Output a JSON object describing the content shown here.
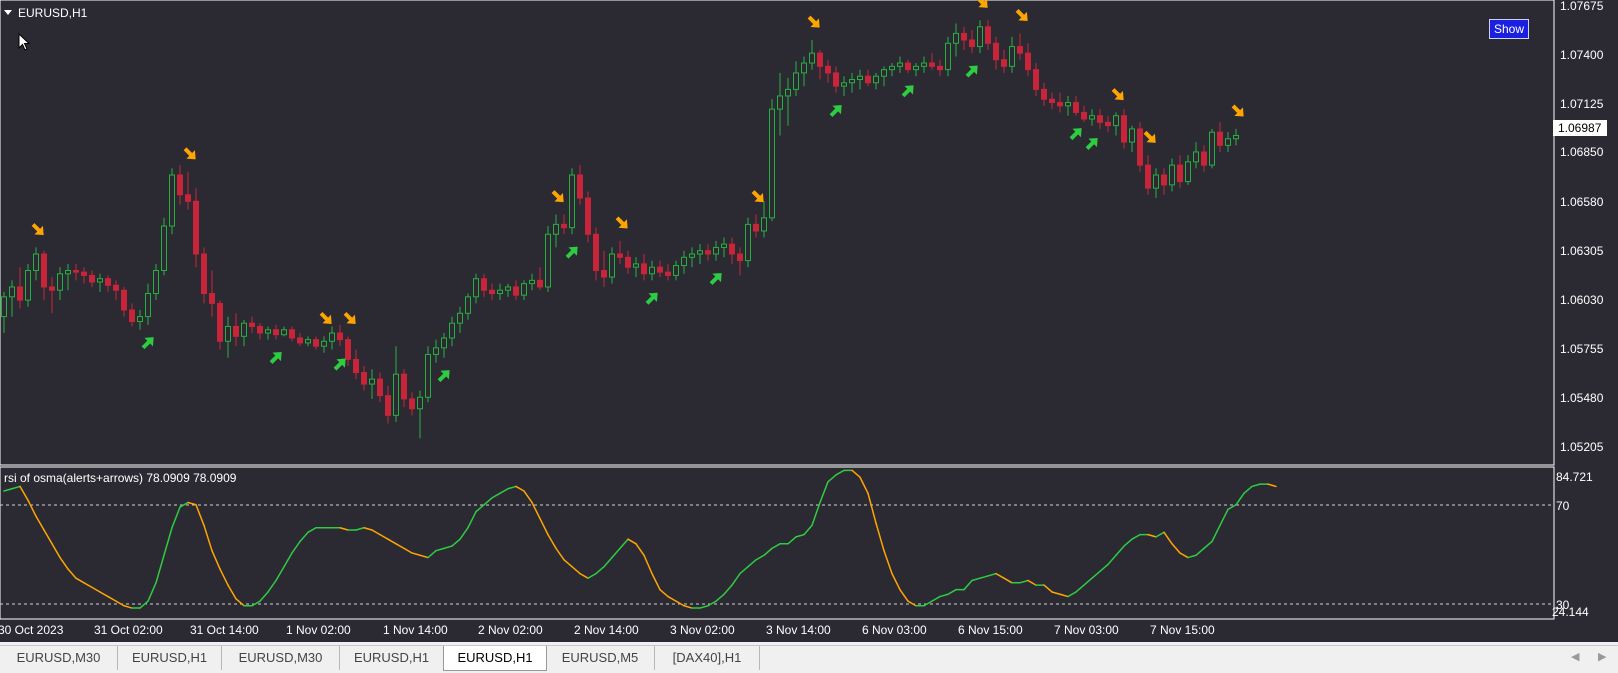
{
  "chart_window": {
    "title": "EURUSD,H1",
    "show_button": "Show",
    "current_price": "1.06987"
  },
  "colors": {
    "background": "#2b2a33",
    "bull": "#26b040",
    "bear": "#c8243a",
    "arrow_up": "#2ecc40",
    "arrow_down": "#ffa500",
    "osc_up": "#2ecc40",
    "osc_down": "#ffa500"
  },
  "price_axis": {
    "labels": [
      "1.07675",
      "1.07400",
      "1.07125",
      "1.06850",
      "1.06580",
      "1.06305",
      "1.06030",
      "1.05755",
      "1.05480",
      "1.05205"
    ]
  },
  "indicator": {
    "title": "rsi of osma(alerts+arrows) 78.0909 78.0909",
    "axis_labels": [
      "84.721",
      "70",
      "30",
      "24.144"
    ]
  },
  "time_axis": {
    "labels": [
      "30 Oct 2023",
      "31 Oct 02:00",
      "31 Oct 14:00",
      "1 Nov 02:00",
      "1 Nov 14:00",
      "2 Nov 02:00",
      "2 Nov 14:00",
      "3 Nov 02:00",
      "3 Nov 14:00",
      "6 Nov 03:00",
      "6 Nov 15:00",
      "7 Nov 03:00",
      "7 Nov 15:00"
    ]
  },
  "tabs": [
    {
      "label": "EURUSD,M30",
      "active": false
    },
    {
      "label": "EURUSD,H1",
      "active": false
    },
    {
      "label": "EURUSD,M30",
      "active": false
    },
    {
      "label": "EURUSD,H1",
      "active": false
    },
    {
      "label": "EURUSD,H1",
      "active": true
    },
    {
      "label": "EURUSD,M5",
      "active": false
    },
    {
      "label": "[DAX40],H1",
      "active": false
    }
  ],
  "chart_data": {
    "type": "candlestick",
    "symbol": "EURUSD",
    "timeframe": "H1",
    "y_range": [
      1.0512,
      1.0775
    ],
    "candles": [
      [
        1.059,
        1.0605,
        1.058,
        1.0602
      ],
      [
        1.0602,
        1.0612,
        1.059,
        1.0608
      ],
      [
        1.0608,
        1.062,
        1.0595,
        1.06
      ],
      [
        1.06,
        1.0622,
        1.0596,
        1.0618
      ],
      [
        1.0618,
        1.0632,
        1.0612,
        1.0628
      ],
      [
        1.0628,
        1.063,
        1.06,
        1.0608
      ],
      [
        1.0608,
        1.0614,
        1.0592,
        1.0606
      ],
      [
        1.0606,
        1.062,
        1.06,
        1.0616
      ],
      [
        1.0616,
        1.0622,
        1.0606,
        1.0618
      ],
      [
        1.0618,
        1.0622,
        1.0612,
        1.0617
      ],
      [
        1.0617,
        1.062,
        1.061,
        1.0615
      ],
      [
        1.0615,
        1.0618,
        1.0608,
        1.0611
      ],
      [
        1.0611,
        1.0616,
        1.0605,
        1.0613
      ],
      [
        1.0613,
        1.0615,
        1.0605,
        1.0609
      ],
      [
        1.0609,
        1.0612,
        1.06,
        1.0606
      ],
      [
        1.0606,
        1.0608,
        1.059,
        1.0594
      ],
      [
        1.0594,
        1.0598,
        1.0584,
        1.0587
      ],
      [
        1.0587,
        1.0594,
        1.0582,
        1.059
      ],
      [
        1.059,
        1.061,
        1.0585,
        1.0604
      ],
      [
        1.0604,
        1.0622,
        1.06,
        1.0618
      ],
      [
        1.0618,
        1.065,
        1.0615,
        1.0645
      ],
      [
        1.0645,
        1.068,
        1.064,
        1.0676
      ],
      [
        1.0676,
        1.0682,
        1.0658,
        1.0664
      ],
      [
        1.0664,
        1.0678,
        1.0655,
        1.066
      ],
      [
        1.066,
        1.0668,
        1.062,
        1.0628
      ],
      [
        1.0628,
        1.0632,
        1.0598,
        1.0604
      ],
      [
        1.0604,
        1.0618,
        1.059,
        1.0598
      ],
      [
        1.0598,
        1.06,
        1.057,
        1.0575
      ],
      [
        1.0575,
        1.059,
        1.0565,
        1.0584
      ],
      [
        1.0584,
        1.0592,
        1.0572,
        1.0578
      ],
      [
        1.0578,
        1.0588,
        1.0572,
        1.0586
      ],
      [
        1.0586,
        1.059,
        1.058,
        1.0584
      ],
      [
        1.0584,
        1.0586,
        1.0576,
        1.058
      ],
      [
        1.058,
        1.0584,
        1.0576,
        1.0582
      ],
      [
        1.0582,
        1.0585,
        1.0576,
        1.0579
      ],
      [
        1.0579,
        1.0584,
        1.0578,
        1.0582
      ],
      [
        1.0582,
        1.0584,
        1.0575,
        1.0577
      ],
      [
        1.0577,
        1.058,
        1.0572,
        1.0574
      ],
      [
        1.0574,
        1.0578,
        1.0572,
        1.0576
      ],
      [
        1.0576,
        1.0578,
        1.057,
        1.0572
      ],
      [
        1.0572,
        1.0578,
        1.0568,
        1.0575
      ],
      [
        1.0575,
        1.0584,
        1.057,
        1.058
      ],
      [
        1.058,
        1.0585,
        1.0572,
        1.0576
      ],
      [
        1.0576,
        1.0578,
        1.056,
        1.0564
      ],
      [
        1.0564,
        1.057,
        1.0552,
        1.0556
      ],
      [
        1.0556,
        1.056,
        1.0545,
        1.0549
      ],
      [
        1.0549,
        1.0558,
        1.054,
        1.0552
      ],
      [
        1.0552,
        1.0556,
        1.0538,
        1.0542
      ],
      [
        1.0542,
        1.0548,
        1.0525,
        1.053
      ],
      [
        1.053,
        1.0572,
        1.0526,
        1.0555
      ],
      [
        1.0555,
        1.0558,
        1.0535,
        1.054
      ],
      [
        1.054,
        1.0544,
        1.053,
        1.0534
      ],
      [
        1.0534,
        1.0545,
        1.0516,
        1.0541
      ],
      [
        1.0541,
        1.0572,
        1.0538,
        1.0567
      ],
      [
        1.0567,
        1.0576,
        1.0562,
        1.0571
      ],
      [
        1.0571,
        1.058,
        1.0565,
        1.0577
      ],
      [
        1.0577,
        1.059,
        1.0572,
        1.0586
      ],
      [
        1.0586,
        1.0596,
        1.058,
        1.0592
      ],
      [
        1.0592,
        1.0604,
        1.0588,
        1.0602
      ],
      [
        1.0602,
        1.0616,
        1.0598,
        1.0613
      ],
      [
        1.0613,
        1.0616,
        1.0602,
        1.0606
      ],
      [
        1.0606,
        1.061,
        1.06,
        1.0604
      ],
      [
        1.0604,
        1.061,
        1.06,
        1.0606
      ],
      [
        1.0606,
        1.061,
        1.0602,
        1.0608
      ],
      [
        1.0608,
        1.0612,
        1.06,
        1.0603
      ],
      [
        1.0603,
        1.0612,
        1.06,
        1.061
      ],
      [
        1.061,
        1.0616,
        1.0606,
        1.0612
      ],
      [
        1.0612,
        1.062,
        1.0606,
        1.0608
      ],
      [
        1.0608,
        1.0645,
        1.0605,
        1.064
      ],
      [
        1.064,
        1.0652,
        1.0632,
        1.0646
      ],
      [
        1.0646,
        1.0652,
        1.064,
        1.0644
      ],
      [
        1.0644,
        1.068,
        1.064,
        1.0676
      ],
      [
        1.0676,
        1.0682,
        1.0658,
        1.0662
      ],
      [
        1.0662,
        1.0666,
        1.0635,
        1.064
      ],
      [
        1.064,
        1.0644,
        1.0612,
        1.0618
      ],
      [
        1.0618,
        1.063,
        1.0608,
        1.0614
      ],
      [
        1.0614,
        1.0632,
        1.061,
        1.0628
      ],
      [
        1.0628,
        1.0636,
        1.0622,
        1.0626
      ],
      [
        1.0626,
        1.063,
        1.0616,
        1.062
      ],
      [
        1.062,
        1.0626,
        1.0614,
        1.0622
      ],
      [
        1.0622,
        1.0628,
        1.0612,
        1.0616
      ],
      [
        1.0616,
        1.0624,
        1.0612,
        1.062
      ],
      [
        1.062,
        1.0624,
        1.0614,
        1.0617
      ],
      [
        1.0617,
        1.0622,
        1.0612,
        1.0615
      ],
      [
        1.0615,
        1.0624,
        1.0612,
        1.0621
      ],
      [
        1.0621,
        1.063,
        1.0616,
        1.0626
      ],
      [
        1.0626,
        1.0632,
        1.062,
        1.0628
      ],
      [
        1.0628,
        1.0634,
        1.0622,
        1.063
      ],
      [
        1.063,
        1.0634,
        1.0624,
        1.0628
      ],
      [
        1.0628,
        1.0636,
        1.0624,
        1.0632
      ],
      [
        1.0632,
        1.0638,
        1.0626,
        1.0634
      ],
      [
        1.0634,
        1.0638,
        1.0622,
        1.0628
      ],
      [
        1.0628,
        1.0632,
        1.0615,
        1.0624
      ],
      [
        1.0624,
        1.065,
        1.062,
        1.0646
      ],
      [
        1.0646,
        1.0652,
        1.0638,
        1.0642
      ],
      [
        1.0642,
        1.066,
        1.0638,
        1.065
      ],
      [
        1.065,
        1.0722,
        1.0648,
        1.0716
      ],
      [
        1.0716,
        1.0738,
        1.07,
        1.0724
      ],
      [
        1.0724,
        1.0735,
        1.0706,
        1.0728
      ],
      [
        1.0728,
        1.0745,
        1.0724,
        1.0738
      ],
      [
        1.0738,
        1.0748,
        1.073,
        1.0744
      ],
      [
        1.0744,
        1.0758,
        1.074,
        1.075
      ],
      [
        1.075,
        1.0752,
        1.0734,
        1.0742
      ],
      [
        1.0742,
        1.0746,
        1.0732,
        1.0738
      ],
      [
        1.0738,
        1.0742,
        1.0726,
        1.073
      ],
      [
        1.073,
        1.0736,
        1.0724,
        1.0732
      ],
      [
        1.0732,
        1.0738,
        1.0726,
        1.0734
      ],
      [
        1.0734,
        1.074,
        1.0728,
        1.0736
      ],
      [
        1.0736,
        1.074,
        1.073,
        1.0732
      ],
      [
        1.0732,
        1.0738,
        1.0728,
        1.0736
      ],
      [
        1.0736,
        1.0742,
        1.073,
        1.074
      ],
      [
        1.074,
        1.0744,
        1.0736,
        1.0742
      ],
      [
        1.0742,
        1.0748,
        1.0738,
        1.0744
      ],
      [
        1.0744,
        1.0746,
        1.0738,
        1.074
      ],
      [
        1.074,
        1.0744,
        1.0736,
        1.0742
      ],
      [
        1.0742,
        1.0748,
        1.0738,
        1.0744
      ],
      [
        1.0744,
        1.075,
        1.074,
        1.0742
      ],
      [
        1.0742,
        1.0746,
        1.0736,
        1.074
      ],
      [
        1.074,
        1.076,
        1.0736,
        1.0756
      ],
      [
        1.0756,
        1.0768,
        1.0748,
        1.0762
      ],
      [
        1.0762,
        1.0766,
        1.0752,
        1.0758
      ],
      [
        1.0758,
        1.0764,
        1.075,
        1.0754
      ],
      [
        1.0754,
        1.077,
        1.075,
        1.0766
      ],
      [
        1.0766,
        1.077,
        1.0752,
        1.0756
      ],
      [
        1.0756,
        1.076,
        1.074,
        1.0746
      ],
      [
        1.0746,
        1.0752,
        1.0738,
        1.0742
      ],
      [
        1.0742,
        1.076,
        1.0738,
        1.0754
      ],
      [
        1.0754,
        1.0762,
        1.0746,
        1.075
      ],
      [
        1.075,
        1.0756,
        1.0736,
        1.074
      ],
      [
        1.074,
        1.0744,
        1.0724,
        1.0728
      ],
      [
        1.0728,
        1.0732,
        1.0718,
        1.0722
      ],
      [
        1.0722,
        1.0726,
        1.0716,
        1.072
      ],
      [
        1.072,
        1.0726,
        1.0714,
        1.0718
      ],
      [
        1.0718,
        1.0724,
        1.0712,
        1.072
      ],
      [
        1.072,
        1.0724,
        1.0712,
        1.0714
      ],
      [
        1.0714,
        1.0718,
        1.0708,
        1.071
      ],
      [
        1.071,
        1.0716,
        1.0706,
        1.0712
      ],
      [
        1.0712,
        1.0716,
        1.0704,
        1.0708
      ],
      [
        1.0708,
        1.0712,
        1.0702,
        1.0706
      ],
      [
        1.0706,
        1.0714,
        1.07,
        1.0712
      ],
      [
        1.0712,
        1.0716,
        1.0692,
        1.0696
      ],
      [
        1.0696,
        1.0706,
        1.069,
        1.0704
      ],
      [
        1.0704,
        1.0708,
        1.0678,
        1.0682
      ],
      [
        1.0682,
        1.0688,
        1.0664,
        1.0668
      ],
      [
        1.0668,
        1.068,
        1.0662,
        1.0676
      ],
      [
        1.0676,
        1.068,
        1.0664,
        1.067
      ],
      [
        1.067,
        1.0686,
        1.0666,
        1.0682
      ],
      [
        1.0682,
        1.0688,
        1.0668,
        1.0672
      ],
      [
        1.0672,
        1.0688,
        1.067,
        1.0684
      ],
      [
        1.0684,
        1.0696,
        1.068,
        1.069
      ],
      [
        1.069,
        1.0694,
        1.0678,
        1.0682
      ],
      [
        1.0682,
        1.0704,
        1.068,
        1.0702
      ],
      [
        1.0702,
        1.0708,
        1.069,
        1.0694
      ],
      [
        1.0694,
        1.0702,
        1.069,
        1.0698
      ],
      [
        1.0698,
        1.0704,
        1.0694,
        1.07
      ]
    ],
    "up_arrow_candle_index": [
      18,
      34,
      42,
      55,
      71,
      81,
      89,
      104,
      113,
      121,
      134,
      136
    ],
    "down_arrow_candle_index": [
      4,
      23,
      40,
      43,
      69,
      77,
      94,
      101,
      122,
      127,
      139,
      143,
      154
    ],
    "oscillator": {
      "name": "rsi of osma(alerts+arrows)",
      "value": 78.0909,
      "levels": [
        70,
        30
      ],
      "y_range": [
        24.144,
        84.721
      ],
      "values": [
        76,
        77,
        78,
        72,
        65,
        59,
        53,
        47,
        42,
        38,
        36,
        34,
        32,
        30,
        28,
        26,
        25,
        25,
        28,
        36,
        48,
        60,
        69,
        71,
        70,
        61,
        50,
        42,
        35,
        29,
        26,
        26,
        28,
        32,
        37,
        43,
        49,
        54,
        58,
        60,
        60,
        60,
        60,
        59,
        59,
        60,
        59,
        57,
        55,
        53,
        51,
        49,
        48,
        47,
        50,
        51,
        52,
        55,
        60,
        67,
        70,
        73,
        75,
        77,
        78,
        76,
        71,
        64,
        57,
        51,
        46,
        43,
        40,
        38,
        40,
        43,
        47,
        51,
        55,
        53,
        48,
        40,
        33,
        30,
        28,
        26,
        25,
        25,
        26,
        28,
        31,
        35,
        40,
        43,
        46,
        48,
        51,
        53,
        53,
        56,
        57,
        61,
        71,
        80,
        83,
        85,
        85,
        82,
        75,
        62,
        50,
        40,
        33,
        28,
        26,
        26,
        28,
        30,
        31,
        33,
        33,
        37,
        38,
        39,
        40,
        38,
        36,
        36,
        37,
        35,
        35,
        32,
        31,
        30,
        32,
        35,
        38,
        41,
        44,
        48,
        52,
        55,
        57,
        57,
        56,
        58,
        53,
        49,
        47,
        48,
        51,
        54,
        61,
        68,
        70,
        75,
        78,
        79,
        79,
        78
      ]
    }
  }
}
